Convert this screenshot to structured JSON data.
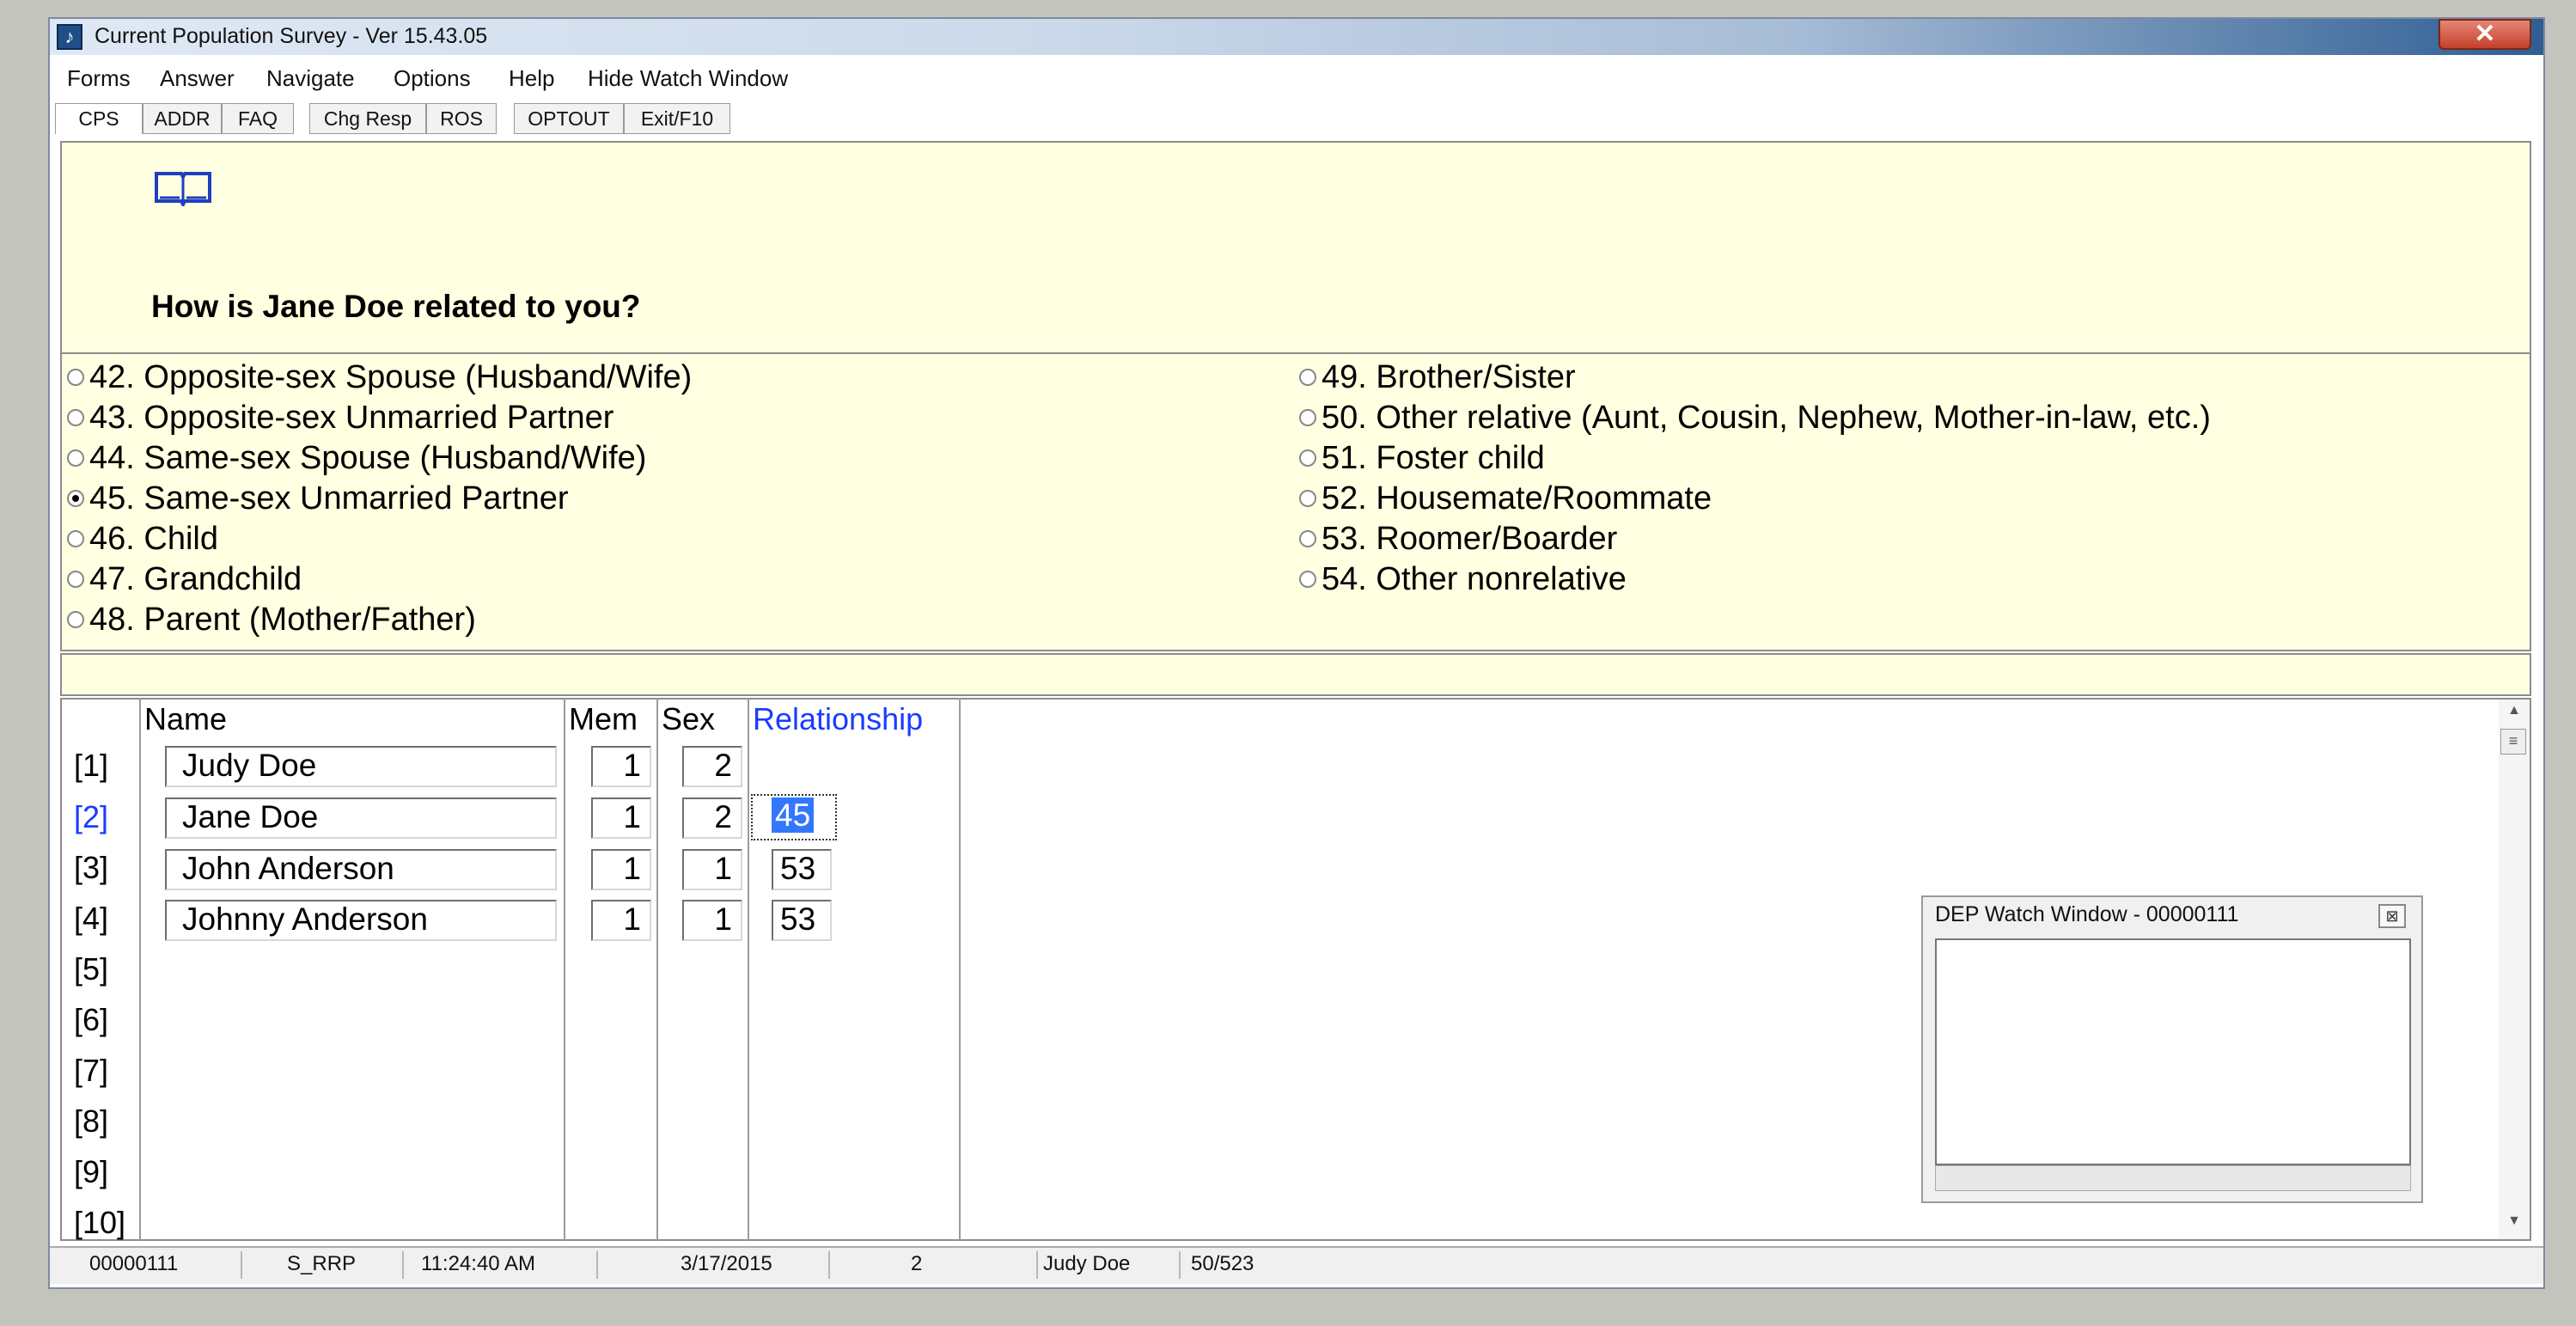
{
  "window": {
    "title": "Current Population Survey - Ver 15.43.05",
    "close_label": "✕"
  },
  "menu": [
    "Forms",
    "Answer",
    "Navigate",
    "Options",
    "Help",
    "Hide Watch Window"
  ],
  "tabs": [
    "CPS",
    "ADDR",
    "FAQ",
    "Chg Resp",
    "ROS",
    "OPTOUT",
    "Exit/F10"
  ],
  "question": {
    "icon": "book-icon",
    "text": "How is Jane Doe related to you?"
  },
  "options_left": [
    {
      "code": "42.",
      "label": "Opposite-sex Spouse (Husband/Wife)",
      "selected": false
    },
    {
      "code": "43.",
      "label": "Opposite-sex Unmarried Partner",
      "selected": false
    },
    {
      "code": "44.",
      "label": "Same-sex Spouse (Husband/Wife)",
      "selected": false
    },
    {
      "code": "45.",
      "label": "Same-sex Unmarried Partner",
      "selected": true
    },
    {
      "code": "46.",
      "label": "Child",
      "selected": false
    },
    {
      "code": "47.",
      "label": "Grandchild",
      "selected": false
    },
    {
      "code": "48.",
      "label": "Parent (Mother/Father)",
      "selected": false
    }
  ],
  "options_right": [
    {
      "code": "49.",
      "label": "Brother/Sister",
      "selected": false
    },
    {
      "code": "50.",
      "label": "Other relative (Aunt, Cousin, Nephew, Mother-in-law, etc.)",
      "selected": false
    },
    {
      "code": "51.",
      "label": "Foster child",
      "selected": false
    },
    {
      "code": "52.",
      "label": "Housemate/Roommate",
      "selected": false
    },
    {
      "code": "53.",
      "label": "Roomer/Boarder",
      "selected": false
    },
    {
      "code": "54.",
      "label": "Other nonrelative",
      "selected": false
    }
  ],
  "grid": {
    "headers": {
      "name": "Name",
      "mem": "Mem",
      "sex": "Sex",
      "relationship": "Relationship"
    },
    "row_labels": [
      "[1]",
      "[2]",
      "[3]",
      "[4]",
      "[5]",
      "[6]",
      "[7]",
      "[8]",
      "[9]",
      "[10]"
    ],
    "rows": [
      {
        "name": "Judy Doe",
        "mem": "1",
        "sex": "2",
        "relationship": ""
      },
      {
        "name": "Jane Doe",
        "mem": "1",
        "sex": "2",
        "relationship": "45"
      },
      {
        "name": "John Anderson",
        "mem": "1",
        "sex": "1",
        "relationship": "53"
      },
      {
        "name": "Johnny Anderson",
        "mem": "1",
        "sex": "1",
        "relationship": "53"
      }
    ],
    "current_row_color": "#1a3cff",
    "relationship_header_color": "#1a3cff"
  },
  "watch_window": {
    "title": "DEP Watch Window - 00000111",
    "close_label": "⊠"
  },
  "status": [
    "00000111",
    "S_RRP",
    "11:24:40 AM",
    "3/17/2015",
    "2",
    "Judy Doe",
    "50/523"
  ]
}
